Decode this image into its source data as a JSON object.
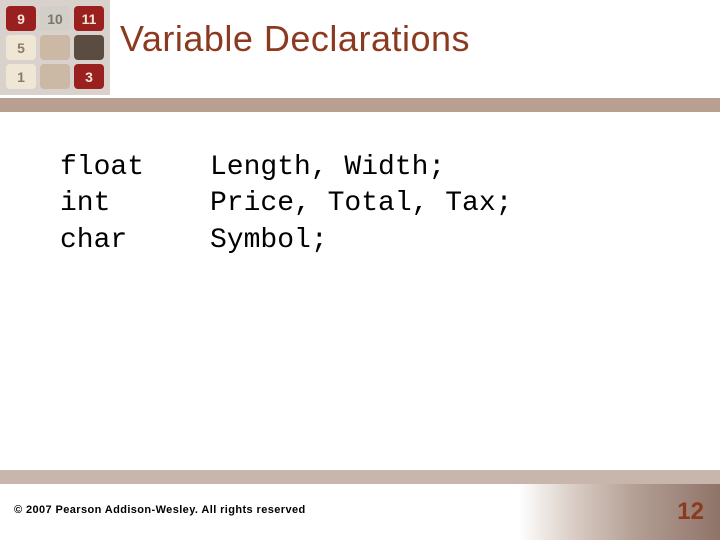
{
  "title": "Variable Declarations",
  "thumb_tiles": [
    "9",
    "10",
    "11",
    "5",
    "",
    "",
    "1",
    "",
    "3"
  ],
  "code": [
    {
      "type": "float",
      "vars": "Length, Width;"
    },
    {
      "type": "int",
      "vars": "Price, Total, Tax;"
    },
    {
      "type": "char",
      "vars": "Symbol;"
    }
  ],
  "footer": {
    "copyright": "© 2007 Pearson Addison-Wesley. All rights reserved",
    "page_number": "12"
  }
}
